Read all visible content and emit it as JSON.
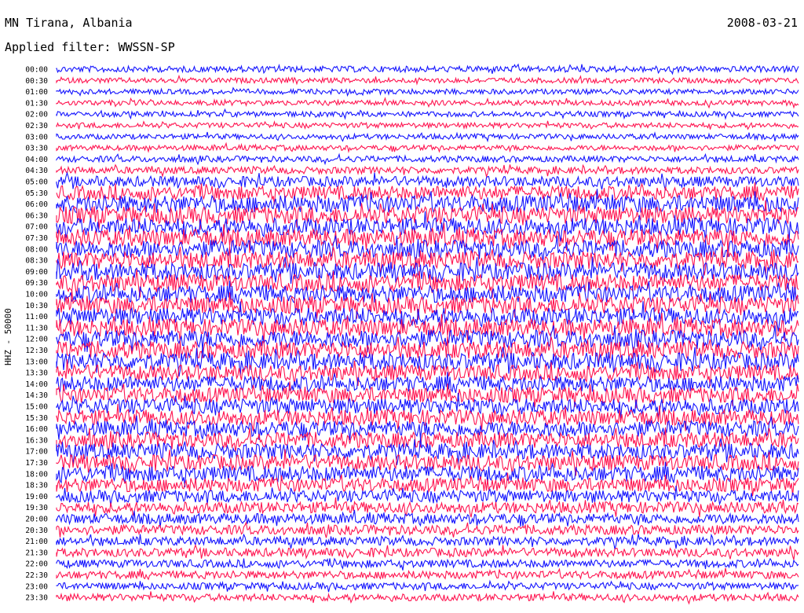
{
  "header": {
    "station": "MN Tirana, Albania",
    "date": "2008-03-21",
    "filter": "Applied filter: WWSSN-SP"
  },
  "chart_data": {
    "type": "line",
    "title": "MN Tirana, Albania",
    "date": "2008-03-21",
    "filter": "WWSSN-SP",
    "ylabel": "HHZ - 50000",
    "row_labels": [
      "00:00",
      "00:30",
      "01:00",
      "01:30",
      "02:00",
      "02:30",
      "03:00",
      "03:30",
      "04:00",
      "04:30",
      "05:00",
      "05:30",
      "06:00",
      "06:30",
      "07:00",
      "07:30",
      "08:00",
      "08:30",
      "09:00",
      "09:30",
      "10:00",
      "10:30",
      "11:00",
      "11:30",
      "12:00",
      "12:30",
      "13:00",
      "13:30",
      "14:00",
      "14:30",
      "15:00",
      "15:30",
      "16:00",
      "16:30",
      "17:00",
      "17:30",
      "18:00",
      "18:30",
      "19:00",
      "19:30",
      "20:00",
      "20:30",
      "21:00",
      "21:30",
      "22:00",
      "22:30",
      "23:00",
      "23:30"
    ],
    "row_amplitude_relative": [
      0.35,
      0.3,
      0.3,
      0.3,
      0.3,
      0.3,
      0.3,
      0.3,
      0.35,
      0.4,
      0.6,
      0.8,
      1.0,
      1.0,
      1.0,
      1.0,
      1.0,
      1.0,
      1.0,
      1.0,
      1.0,
      1.0,
      1.0,
      1.0,
      1.0,
      1.0,
      1.0,
      0.9,
      0.9,
      0.9,
      0.9,
      0.9,
      0.9,
      0.9,
      0.9,
      0.9,
      0.9,
      0.8,
      0.7,
      0.65,
      0.6,
      0.55,
      0.5,
      0.5,
      0.45,
      0.45,
      0.4,
      0.4
    ],
    "series_colors": [
      "#1414ff",
      "#ff1450"
    ],
    "grid": false
  }
}
